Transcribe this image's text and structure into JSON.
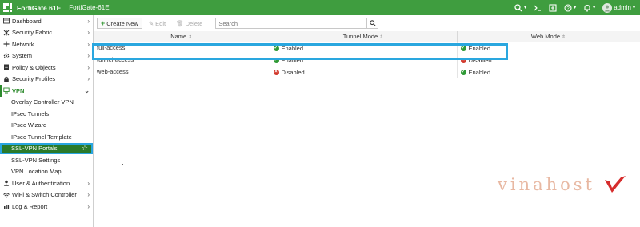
{
  "topbar": {
    "brand": "FortiGate 61E",
    "hostname": "FortiGate-61E",
    "user": "admin"
  },
  "sidebar": {
    "items": [
      {
        "label": "Dashboard",
        "icon": "dashboard-icon"
      },
      {
        "label": "Security Fabric",
        "icon": "fabric-icon"
      },
      {
        "label": "Network",
        "icon": "network-icon"
      },
      {
        "label": "System",
        "icon": "gear-icon"
      },
      {
        "label": "Policy & Objects",
        "icon": "policy-icon"
      },
      {
        "label": "Security Profiles",
        "icon": "lock-icon"
      },
      {
        "label": "VPN",
        "icon": "vpn-icon"
      }
    ],
    "vpn_sub": [
      {
        "label": "Overlay Controller VPN"
      },
      {
        "label": "IPsec Tunnels"
      },
      {
        "label": "IPsec Wizard"
      },
      {
        "label": "IPsec Tunnel Template"
      },
      {
        "label": "SSL-VPN Portals"
      },
      {
        "label": "SSL-VPN Settings"
      },
      {
        "label": "VPN Location Map"
      }
    ],
    "bottom_items": [
      {
        "label": "User & Authentication",
        "icon": "user-icon"
      },
      {
        "label": "WiFi & Switch Controller",
        "icon": "wifi-icon"
      },
      {
        "label": "Log & Report",
        "icon": "chart-icon"
      }
    ]
  },
  "toolbar": {
    "create_label": "Create New",
    "edit_label": "Edit",
    "delete_label": "Delete",
    "search_placeholder": "Search"
  },
  "table": {
    "columns": [
      "Name",
      "Tunnel Mode",
      "Web Mode"
    ],
    "rows": [
      {
        "name": "full-access",
        "tunnel": "Enabled",
        "web": "Enabled"
      },
      {
        "name": "tunnel-access",
        "tunnel": "Enabled",
        "web": "Disabled"
      },
      {
        "name": "web-access",
        "tunnel": "Disabled",
        "web": "Enabled"
      }
    ]
  },
  "watermark": "vinahost",
  "colors": {
    "topbar": "#3f9d3f",
    "active_item": "#2a7a2a",
    "highlight": "#2aa7df",
    "enabled": "#2f9a36",
    "disabled": "#d23a2e"
  }
}
